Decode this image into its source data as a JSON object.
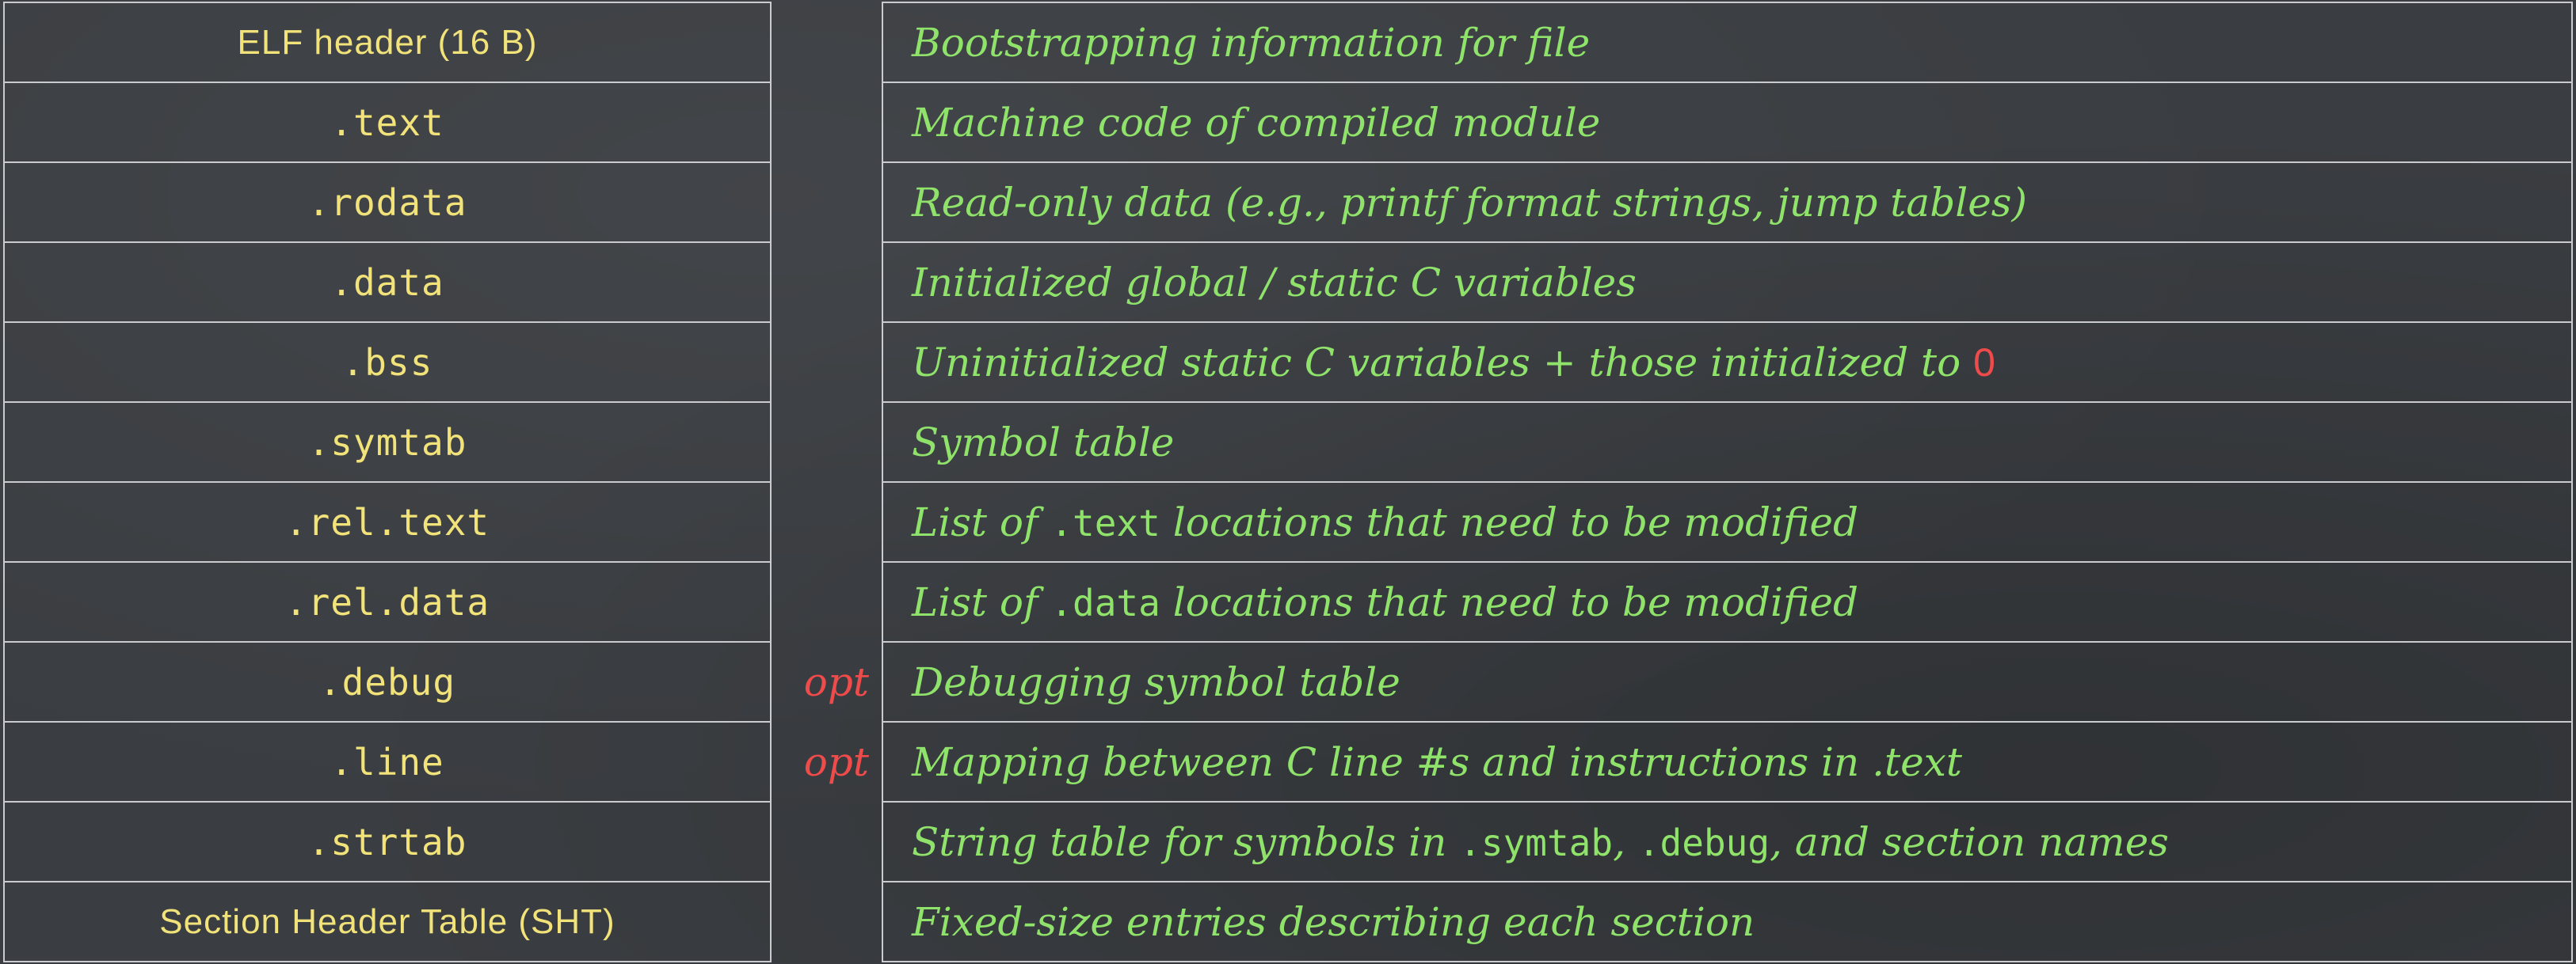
{
  "colors": {
    "background": "#3a3d41",
    "grid": "#c9cbcf",
    "section_text": "#f1e27a",
    "description_text": "#8fe36a",
    "highlight": "#ef4b4b"
  },
  "rows": [
    {
      "section": "ELF header (16 B)",
      "section_style": "sans",
      "opt": "",
      "desc": [
        {
          "t": "Bootstrapping information for file"
        }
      ]
    },
    {
      "section": ".text",
      "section_style": "mono",
      "opt": "",
      "desc": [
        {
          "t": "Machine code of compiled module"
        }
      ]
    },
    {
      "section": ".rodata",
      "section_style": "mono",
      "opt": "",
      "desc": [
        {
          "t": "Read-only data (e.g., printf format strings, jump tables)"
        }
      ]
    },
    {
      "section": ".data",
      "section_style": "mono",
      "opt": "",
      "desc": [
        {
          "t": "Initialized global / static C variables"
        }
      ]
    },
    {
      "section": ".bss",
      "section_style": "mono",
      "opt": "",
      "desc": [
        {
          "t": "Uninitialized static C variables + those initialized to "
        },
        {
          "t": "0",
          "style": "zero"
        }
      ]
    },
    {
      "section": ".symtab",
      "section_style": "mono",
      "opt": "",
      "desc": [
        {
          "t": "Symbol table"
        }
      ]
    },
    {
      "section": ".rel.text",
      "section_style": "mono",
      "opt": "",
      "desc": [
        {
          "t": "List of "
        },
        {
          "t": ".text",
          "style": "mono"
        },
        {
          "t": " locations that need to be modified"
        }
      ]
    },
    {
      "section": ".rel.data",
      "section_style": "mono",
      "opt": "",
      "desc": [
        {
          "t": "List of "
        },
        {
          "t": ".data",
          "style": "mono"
        },
        {
          "t": " locations that need to be modified"
        }
      ]
    },
    {
      "section": ".debug",
      "section_style": "mono",
      "opt": "opt",
      "desc": [
        {
          "t": "Debugging symbol table"
        }
      ]
    },
    {
      "section": ".line",
      "section_style": "mono",
      "opt": "opt",
      "desc": [
        {
          "t": "Mapping between C line #s and instructions in .text"
        }
      ]
    },
    {
      "section": ".strtab",
      "section_style": "mono",
      "opt": "",
      "desc": [
        {
          "t": "String table for symbols in "
        },
        {
          "t": ".symtab",
          "style": "mono"
        },
        {
          "t": ", "
        },
        {
          "t": ".debug",
          "style": "mono"
        },
        {
          "t": ", and section names"
        }
      ]
    },
    {
      "section": "Section Header Table (SHT)",
      "section_style": "sans",
      "opt": "",
      "desc": [
        {
          "t": "Fixed-size entries describing each section"
        }
      ]
    }
  ]
}
